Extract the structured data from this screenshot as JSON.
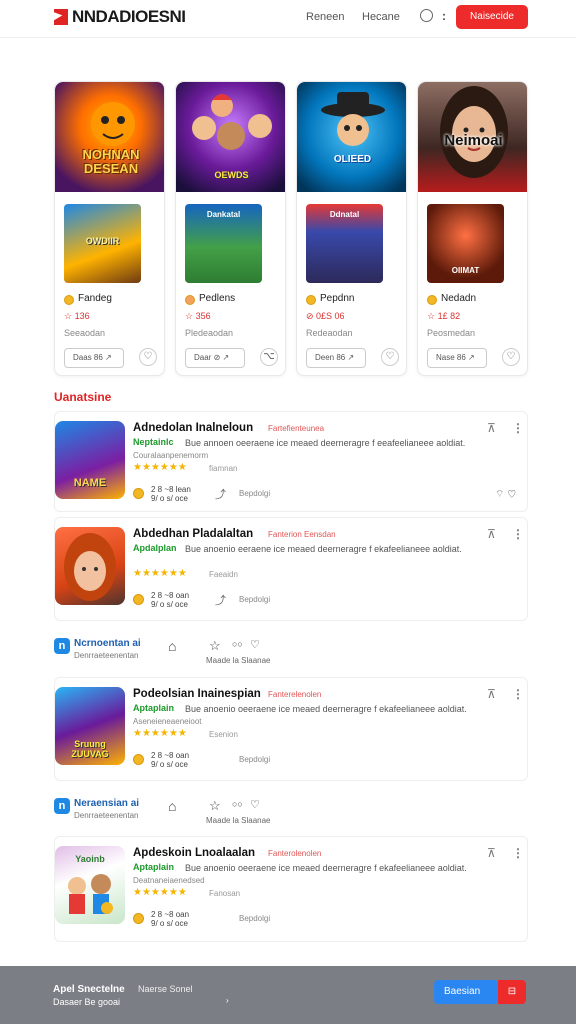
{
  "header": {
    "logo_text": "NNDADIOESNI",
    "nav": [
      "Reneen",
      "Hecane"
    ],
    "dots": ":",
    "cta_label": "Naisecide"
  },
  "cards": [
    {
      "hero_text": "NOHNAN DESEAN",
      "thumb_text": "OWDIIR",
      "name": "Fandeg",
      "rating": "☆ 136",
      "sub": "Seeaodan",
      "pill": "Daas  86  ↗",
      "heart": "♡"
    },
    {
      "hero_text": "OEWDS",
      "thumb_text": "Dankatal",
      "name": "Pedlens",
      "rating": "☆ 356",
      "sub": "Pledeaodan",
      "pill": "Daar  ⊘  ↗",
      "heart": "⌥"
    },
    {
      "hero_text": "OLIEED",
      "thumb_text": "Ddnatal",
      "name": "Pepdnn",
      "rating": "⊘ 0£S 06",
      "sub": "Redeaodan",
      "pill": "Deen  86  ↗",
      "heart": "♡"
    },
    {
      "hero_text": "Neimoai",
      "thumb_text": "OIIMAT",
      "name": "Nedadn",
      "rating": "☆ 1£ 82",
      "sub": "Peosmedan",
      "pill": "Nase  86  ↗",
      "heart": "♡"
    }
  ],
  "section_title": "Uanatsine",
  "rows": [
    {
      "icon_text": "NAME",
      "title": "Adnedolan Inalneloun",
      "tag": "Fartefienteunea",
      "label": "Neptainlc",
      "desc": "Bue annoen oeeraene ice meaed  deerneragre f eeafeelianeee aoldiat.",
      "meta": "Couralaanpenemorm",
      "stars": "★★★★★★",
      "reviews": "fiamnan",
      "count": "2 8 ~8 lean\n9/ o s/ oce",
      "loc": "Bepdolgi",
      "share": "⌔ ♡"
    },
    {
      "icon_text": "",
      "title": "Abdedhan Pladalaltan",
      "tag": "Fanterion Eensdan",
      "label": "Apdalplan",
      "desc": "Bue anoenio eeraene ice meaed  deerneragre f ekafeelianeee aoldiat.",
      "meta": "",
      "stars": "★★★★★★",
      "reviews": "Faeaidn",
      "count": "2 8 ~8 oan\n9/ o s/ oce",
      "loc": "Bepdolgi",
      "share": ""
    },
    {
      "icon_text": "Sruung ZUUVAG",
      "title": "Podeolsian Inainespian",
      "tag": "Fanterelenolen",
      "label": "Aptaplain",
      "desc": "Bue anoenio oeeraene ice meaed  deerneragre f ekafeelianeee aoldiat.",
      "meta": "Aseneieneaeneioot",
      "stars": "★★★★★★",
      "reviews": "Esenion",
      "count": "2 8 ~8 oan\n9/ o s/ oce",
      "loc": "Bepdolgi",
      "share": ""
    },
    {
      "icon_text": "Yaoinb",
      "title": "Apdeskoin Lnoalaalan",
      "tag": "Fanterolenolen",
      "label": "Aptaplain",
      "desc": "Bue anoenio oeeraene ice meaed  deerneragre f ekafeelianeee aoldiat.",
      "meta": "Deatnaneiaenedsed",
      "stars": "★★★★★★",
      "reviews": "Fanosan",
      "count": "2 8 ~8 oan\n9/ o s/ oce",
      "loc": "Bepdolgi",
      "share": ""
    }
  ],
  "strips": [
    {
      "icon": "n",
      "title": "Ncrnoentan  ai",
      "sub": "Denrraeteenentan",
      "label": "Maade  la  Slaanae"
    },
    {
      "icon": "n",
      "title": "Neraensian  ai",
      "sub": "Denrraeteenentan",
      "label": "Maade  la  Slaanae"
    }
  ],
  "footer": {
    "title": "Apel Snectelne",
    "sub": "Dasaer Be gooai",
    "link": "Naerse Sonel",
    "chev": "›",
    "button": "Baesian",
    "red": "⊟"
  }
}
